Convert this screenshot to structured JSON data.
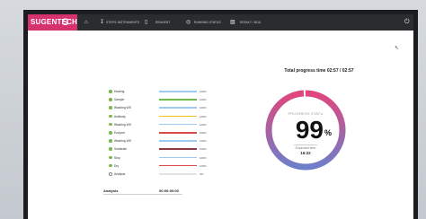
{
  "app": {
    "brand": "SUGENTECH",
    "brand_mark": "S"
  },
  "nav": {
    "home_icon": "home-icon",
    "items": [
      {
        "label": "STEP/1 INSTRUMENTS",
        "icon": "download-icon"
      },
      {
        "label": "REAGENT",
        "icon": "reagent-icon"
      },
      {
        "label": "RUNNING STATUS",
        "icon": "status-icon"
      },
      {
        "label": "RESULT / BGA",
        "icon": "document-icon"
      }
    ],
    "power_icon": "power-icon"
  },
  "steps": [
    {
      "label": "Heating",
      "percent": "100%",
      "fill": 1.0,
      "color": "#9ec9f0",
      "done": true
    },
    {
      "label": "Sample",
      "percent": "100%",
      "fill": 1.0,
      "color": "#6dbb4a",
      "done": true
    },
    {
      "label": "Washing WS",
      "percent": "100%",
      "fill": 1.0,
      "color": "#9ec9f0",
      "done": true
    },
    {
      "label": "Antibody",
      "percent": "100%",
      "fill": 1.0,
      "color": "#f0c419",
      "done": true
    },
    {
      "label": "Washing WS",
      "percent": "100%",
      "fill": 1.0,
      "color": "#9ec9f0",
      "done": true
    },
    {
      "label": "Enzyme",
      "percent": "100%",
      "fill": 1.0,
      "color": "#d94b4b",
      "done": true
    },
    {
      "label": "Washing WS",
      "percent": "100%",
      "fill": 1.0,
      "color": "#9ec9f0",
      "done": true
    },
    {
      "label": "Substrate",
      "percent": "100%",
      "fill": 1.0,
      "color": "#8a3a3a",
      "done": true
    },
    {
      "label": "Stop",
      "percent": "100%",
      "fill": 1.0,
      "color": "#9ec9f0",
      "done": true
    },
    {
      "label": "Dry",
      "percent": "100%",
      "fill": 1.0,
      "color": "#d94b4b",
      "done": true
    },
    {
      "label": "Analysis",
      "percent": "0%",
      "fill": 0.0,
      "color": "#9ec9f0",
      "done": false
    }
  ],
  "analysis": {
    "label": "Analysis",
    "time": "00:00:00:00"
  },
  "progress": {
    "title": "Total progress time 02:57 / 02:57",
    "ring_label": "PROGRESS STATU",
    "value": "99",
    "percent_sign": "%",
    "fraction": 0.99,
    "expected_label": "Expected time",
    "expected_time": "16:22",
    "colors": {
      "start": "#6e7fc9",
      "end": "#e0467d"
    }
  }
}
